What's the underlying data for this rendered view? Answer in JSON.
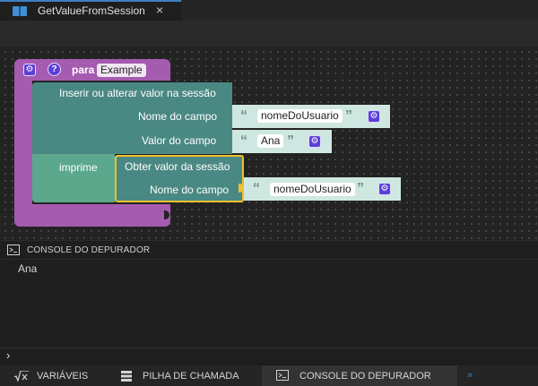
{
  "tab": {
    "title": "GetValueFromSession",
    "close": "×"
  },
  "blocks": {
    "procedure": {
      "keyword": "para",
      "name": "Example"
    },
    "set_session": {
      "title": "Inserir ou alterar valor na sessão",
      "field_name_label": "Nome do campo",
      "field_name_value": "nomeDoUsuario",
      "field_value_label": "Valor do campo",
      "field_value_value": "Ana"
    },
    "print": {
      "label": "imprime"
    },
    "get_session": {
      "title": "Obter valor da sessão",
      "field_name_label": "Nome do campo",
      "field_name_value": "nomeDoUsuario"
    },
    "open_quote": "“",
    "close_quote": "”"
  },
  "console": {
    "title": "CONSOLE DO DEPURADOR",
    "output": "Ana",
    "prompt": "›"
  },
  "bottom_tabs": [
    {
      "label": "VARIÁVEIS",
      "icon": "function-icon"
    },
    {
      "label": "PILHA DE CHAMADA",
      "icon": "stack-icon"
    },
    {
      "label": "CONSOLE DO DEPURADOR",
      "icon": "terminal-icon",
      "active": true
    }
  ],
  "more_label": "»",
  "colors": {
    "procedure_block": "#a55bb0",
    "session_block": "#4a8883",
    "print_block": "#5ba88d",
    "string_block": "#cfe7e1",
    "selection_outline": "#f0c030",
    "accent": "#3d7fc1"
  }
}
